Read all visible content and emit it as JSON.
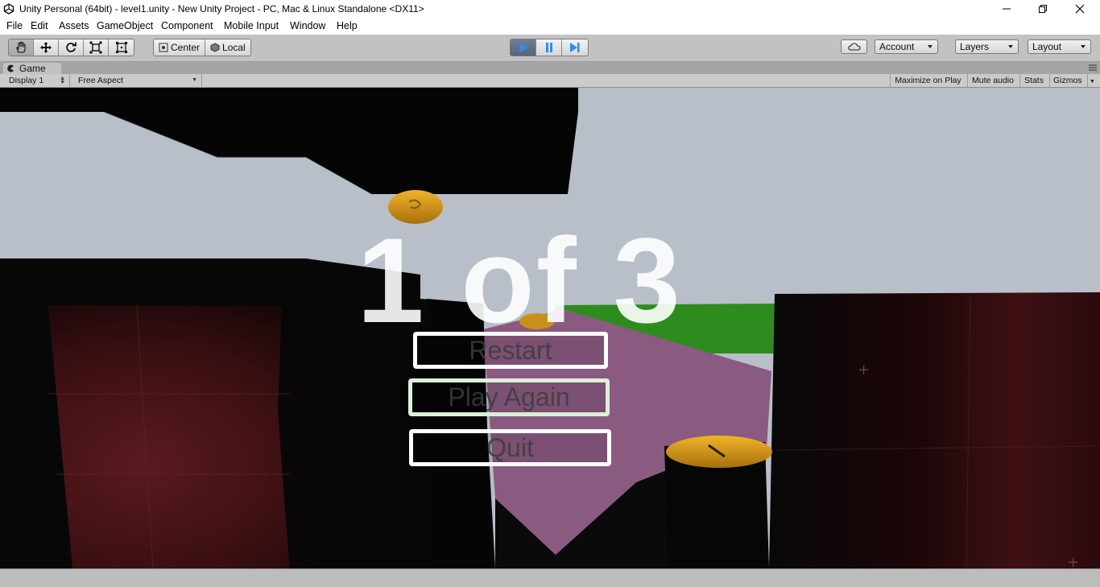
{
  "window": {
    "title": "Unity Personal (64bit) - level1.unity - New Unity Project - PC, Mac & Linux Standalone <DX11>",
    "controls": [
      "minimize",
      "maximize",
      "close"
    ]
  },
  "menu": {
    "items": [
      "File",
      "Edit",
      "Assets",
      "GameObject",
      "Component",
      "Mobile Input",
      "Window",
      "Help"
    ]
  },
  "toolbar": {
    "transform_tools": [
      {
        "icon": "hand-icon",
        "active": true
      },
      {
        "icon": "move-icon",
        "active": false
      },
      {
        "icon": "rotate-icon",
        "active": false
      },
      {
        "icon": "scale-icon",
        "active": false
      },
      {
        "icon": "rect-icon",
        "active": false
      }
    ],
    "pivot_label": "Center",
    "space_label": "Local",
    "play_controls": [
      {
        "icon": "play-icon",
        "active": true
      },
      {
        "icon": "pause-icon",
        "active": false
      },
      {
        "icon": "step-icon",
        "active": false
      }
    ],
    "account_label": "Account",
    "layers_label": "Layers",
    "layout_label": "Layout"
  },
  "game_panel": {
    "tab_label": "Game",
    "display_label": "Display 1",
    "aspect_label": "Free Aspect",
    "maximize_label": "Maximize on Play",
    "mute_label": "Mute audio",
    "stats_label": "Stats",
    "gizmos_label": "Gizmos"
  },
  "game_ui": {
    "result_text": "1 of 3",
    "buttons": {
      "restart": "Restart",
      "play_again": "Play Again",
      "quit": "Quit"
    }
  },
  "colors": {
    "sky": "#b8bfc8",
    "grass": "#2e8c1e",
    "floor_pink": "#8a5a80",
    "wall_dark_red": "#4a1418",
    "coin_gold": "#d89a18",
    "play_active": "#566478"
  }
}
